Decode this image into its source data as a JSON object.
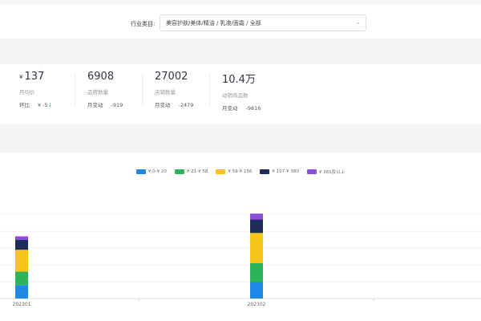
{
  "filter": {
    "label": "行业类目:",
    "value": "美容护肤/美体/精油 / 乳液/面霜 / 全部"
  },
  "stats": [
    {
      "currency": "¥",
      "value": "137",
      "label": "月均价",
      "change_label": "环比",
      "change_value": "¥ -5",
      "arrow": "↓"
    },
    {
      "currency": "",
      "value": "6908",
      "label": "品牌数量",
      "change_label": "月变动",
      "change_value": "-919",
      "arrow": ""
    },
    {
      "currency": "",
      "value": "27002",
      "label": "店铺数量",
      "change_label": "月变动",
      "change_value": "-2479",
      "arrow": ""
    },
    {
      "currency": "",
      "value": "10.4万",
      "label": "动销商品数",
      "change_label": "月变动",
      "change_value": "-9816",
      "arrow": ""
    }
  ],
  "colors": {
    "down": "#2ebd85"
  },
  "chart_data": {
    "type": "bar",
    "stacked": true,
    "categories": [
      "202301",
      "202302"
    ],
    "series": [
      {
        "name": "¥ 0-¥ 20",
        "color": "#1e88e5",
        "values": [
          16,
          20
        ]
      },
      {
        "name": "¥ 21-¥ 58",
        "color": "#2fb35a",
        "values": [
          16,
          22
        ]
      },
      {
        "name": "¥ 59-¥ 156",
        "color": "#f5c518",
        "values": [
          26,
          36
        ]
      },
      {
        "name": "¥ 157-¥ 380",
        "color": "#1f2d5c",
        "values": [
          12,
          16
        ]
      },
      {
        "name": "¥ 381及以上",
        "color": "#8a4fd8",
        "values": [
          4,
          7
        ]
      }
    ],
    "ylim": [
      0,
      105
    ],
    "grid": true,
    "legend_position": "top"
  }
}
